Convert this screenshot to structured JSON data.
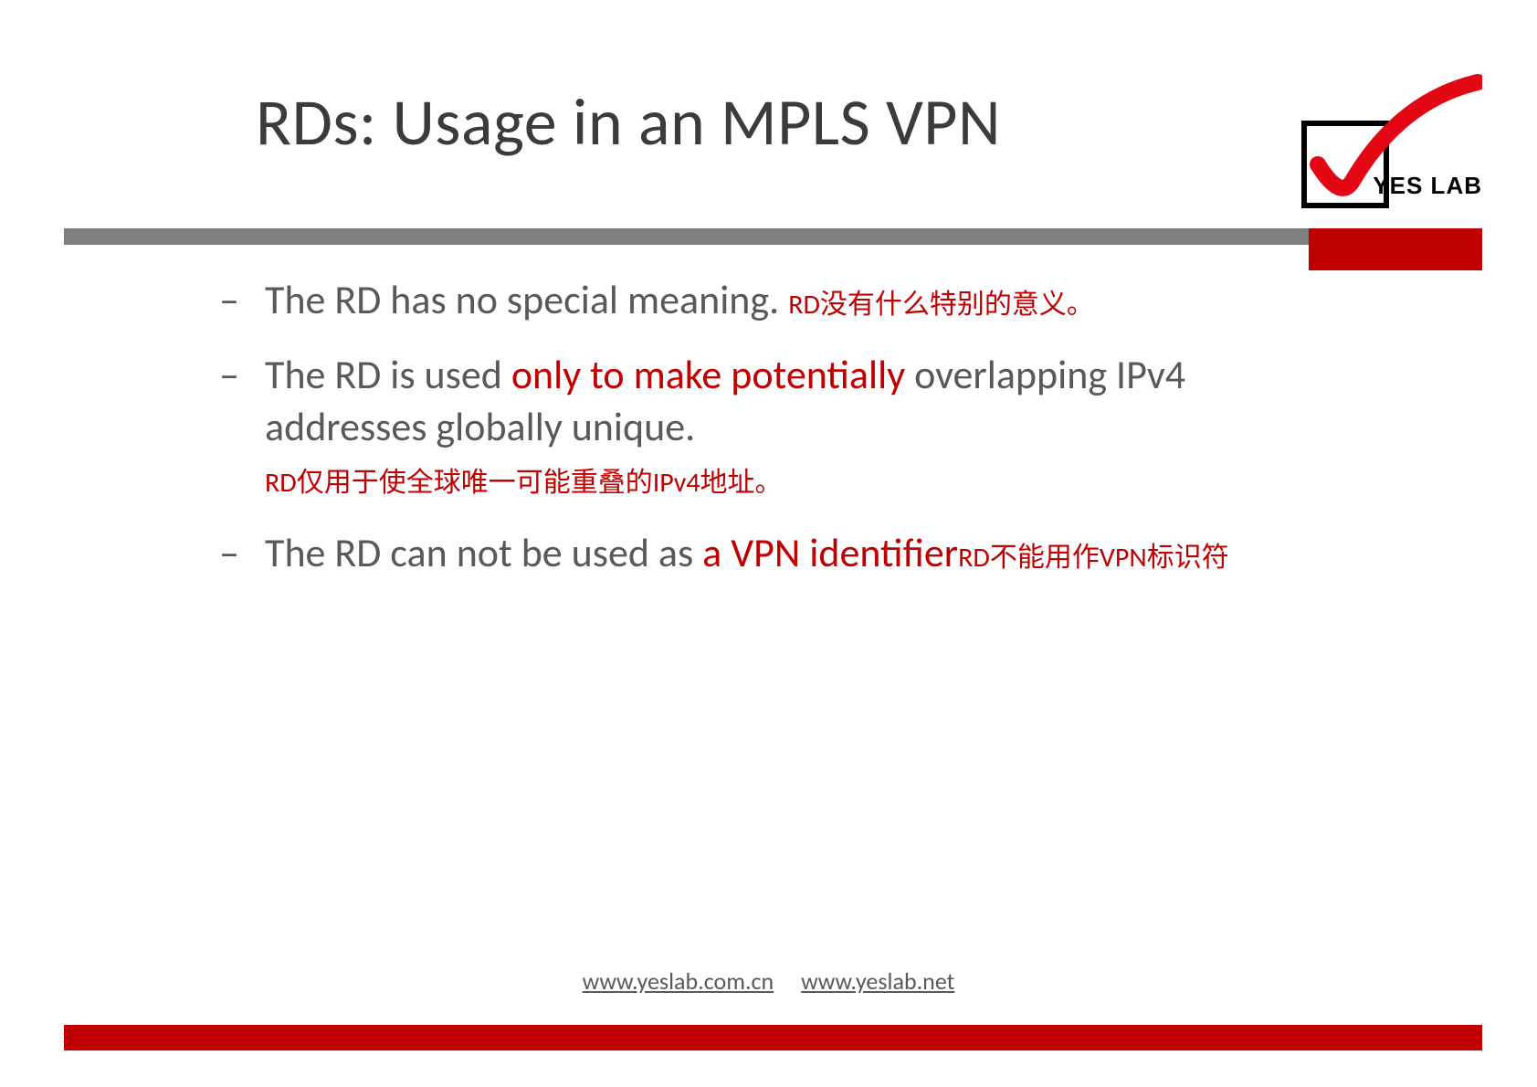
{
  "title": "RDs: Usage in an MPLS VPN",
  "logo_label": "YES LAB",
  "bullets": {
    "b1": {
      "main_prefix": "The RD has no special meaning. ",
      "anno": "RD没有什么特别的意义。"
    },
    "b2": {
      "prefix": "The RD is used ",
      "mid_red": "only to make potentially",
      "suffix1": " overlapping IPv4 addresses globally unique.",
      "anno": "RD仅用于使全球唯一可能重叠的IPv4地址。"
    },
    "b3": {
      "prefix": "The RD can not be used as ",
      "mid_red": "a VPN identifier",
      "anno": "RD不能用作VPN标识符"
    }
  },
  "footer": {
    "link1": "www.yeslab.com.cn",
    "link2": "www.yeslab.net"
  }
}
